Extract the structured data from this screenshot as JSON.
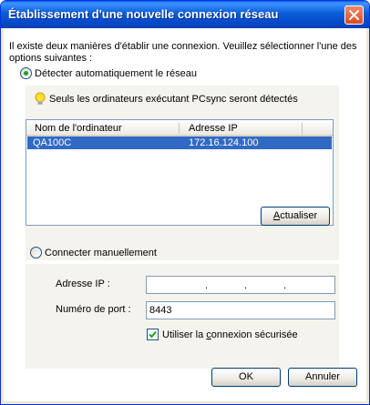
{
  "window": {
    "title": "Établissement d'une nouvelle connexion réseau"
  },
  "intro": "Il existe deux manières d'établir une connexion. Veuillez sélectionner l'une des options suivantes :",
  "auto": {
    "label": "Détecter automatiquement le réseau",
    "checked": true,
    "hint": "Seuls les ordinateurs exécutant PCsync seront détectés",
    "columns": [
      "Nom de l'ordinateur",
      "Adresse IP"
    ],
    "rows": [
      {
        "name": "QA100C",
        "ip": "172.16.124.100"
      }
    ],
    "refresh_button": {
      "prefix": "",
      "mnemonic": "A",
      "rest": "ctualiser"
    }
  },
  "manual": {
    "label": "Connecter manuellement",
    "checked": false,
    "ip_label": "Adresse IP :",
    "ip_value": "",
    "port_label": "Numéro de port :",
    "port_value": "8443",
    "secure": {
      "checked": true,
      "prefix": "Utiliser la ",
      "mnemonic": "c",
      "rest": "onnexion sécurisée"
    }
  },
  "buttons": {
    "ok": "OK",
    "cancel": "Annuler"
  },
  "colors": {
    "selection": "#316ac5",
    "titlebar": "#0a5ed8",
    "close": "#d84a22"
  },
  "icons": {
    "close": "close-icon",
    "hint": "lightbulb-icon",
    "check": "checkmark-icon"
  }
}
